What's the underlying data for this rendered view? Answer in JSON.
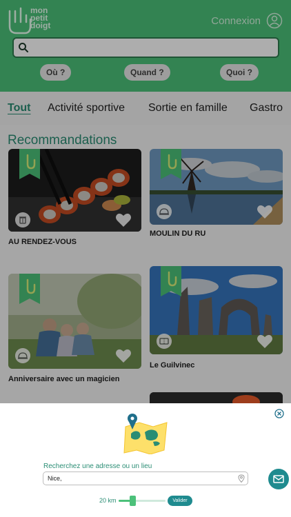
{
  "header": {
    "logo_text": [
      "mon",
      "petit",
      "doigt"
    ],
    "login_label": "Connexion",
    "search": {
      "placeholder": "",
      "value": ""
    },
    "filters": [
      {
        "label": "Où ?"
      },
      {
        "label": "Quand ?"
      },
      {
        "label": "Quoi ?"
      }
    ]
  },
  "tabs": [
    {
      "label": "Tout",
      "active": true
    },
    {
      "label": "Activité sportive",
      "active": false
    },
    {
      "label": "Sortie en famille",
      "active": false
    },
    {
      "label": "Gastro",
      "active": false
    }
  ],
  "section": {
    "title": "Recommandations"
  },
  "cards": [
    {
      "title": "AU RENDEZ-VOUS",
      "category_icon": "trash-icon",
      "photo": "sushi"
    },
    {
      "title": "MOULIN DU RU",
      "category_icon": "cloche-icon",
      "photo": "windmill"
    },
    {
      "title": "Anniversaire avec un magicien",
      "category_icon": "cloche-icon",
      "photo": "family"
    },
    {
      "title": "Le Guilvinec",
      "category_icon": "ticket-icon",
      "photo": "ruins"
    }
  ],
  "sheet": {
    "address_label": "Recherchez une adresse ou un lieu",
    "address_value": "Nice,",
    "range_label": "20 km",
    "range_fraction": 0.3,
    "validate_label": "Valider"
  },
  "colors": {
    "brand_green": "#4cc17a",
    "teal": "#2a8d74",
    "button_teal": "#1f8b8f"
  }
}
